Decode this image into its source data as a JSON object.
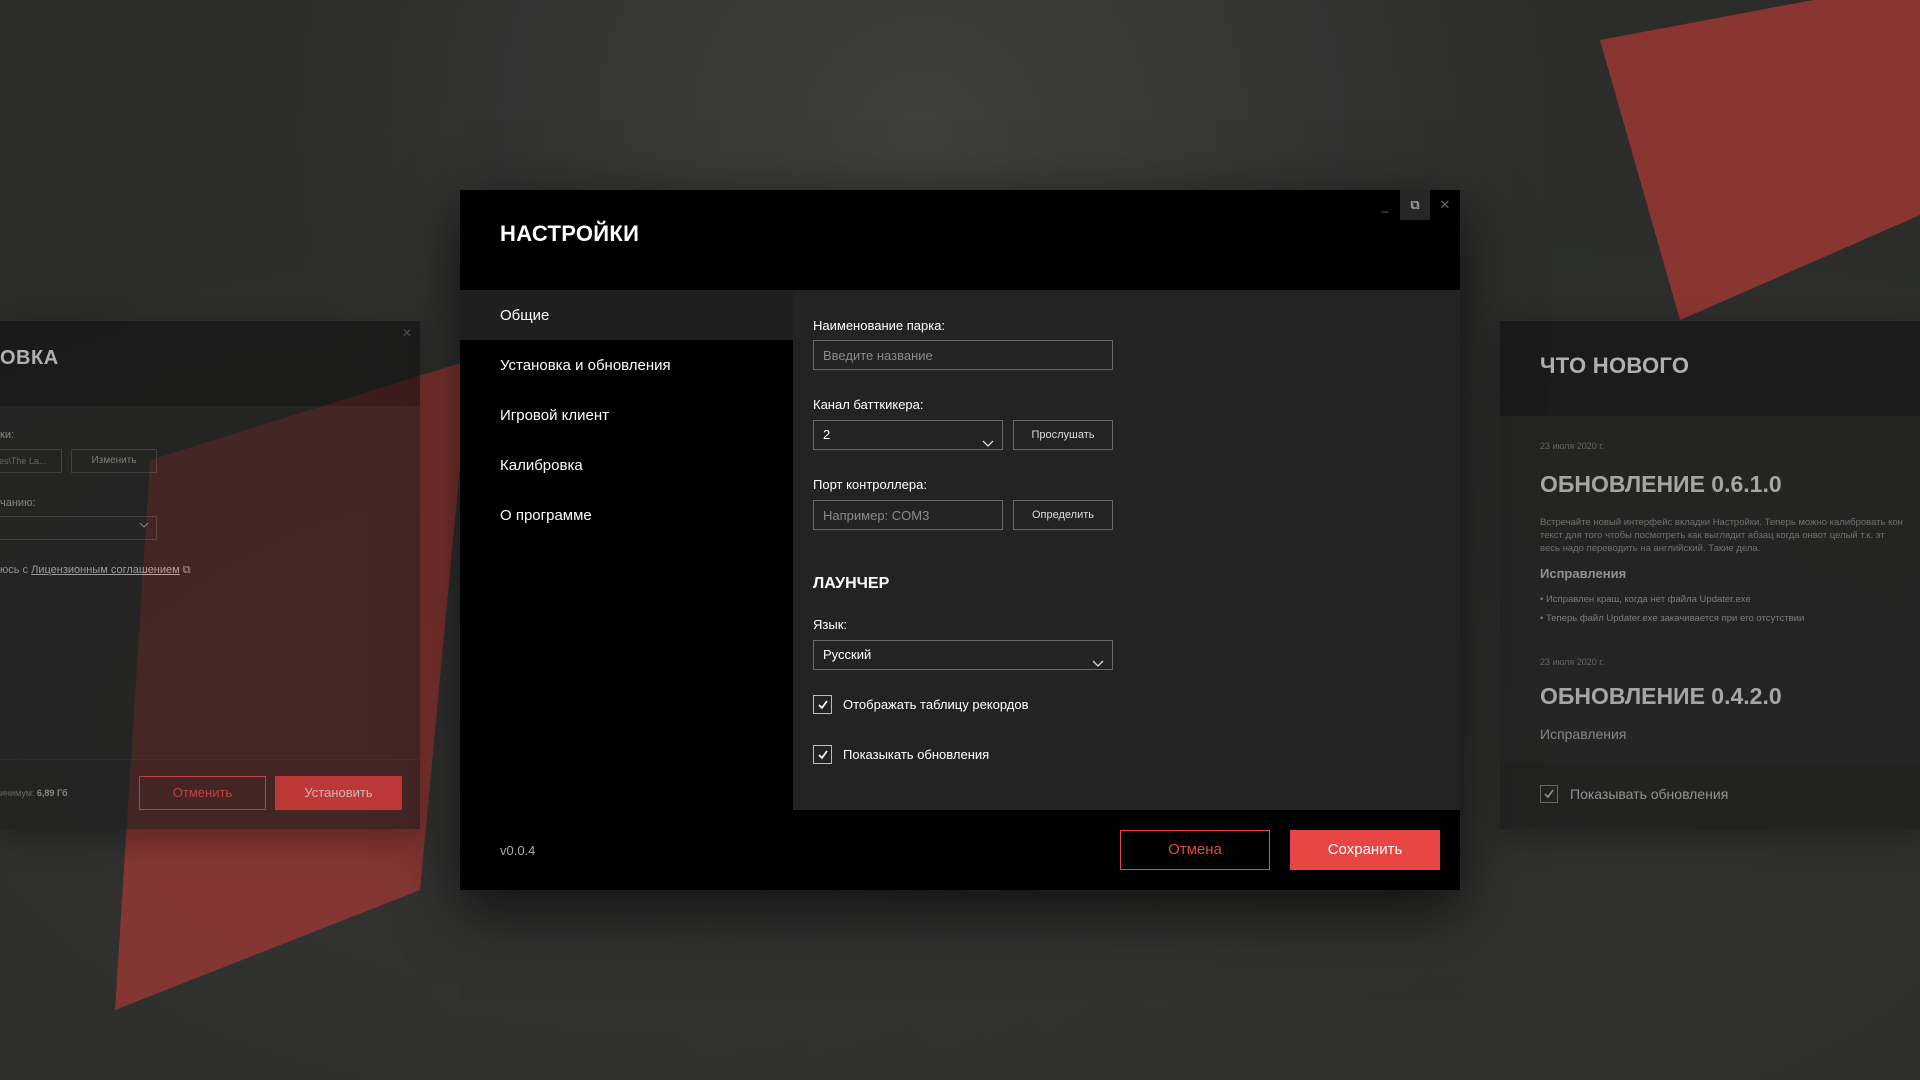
{
  "background": {
    "accent_color": "#c0403d"
  },
  "installer": {
    "title": "ОВКА",
    "path_label": "ки:",
    "path_value": "es\\The La...",
    "change_button": "Изменить",
    "default_label": "чанию:",
    "agree_text": "юсь с",
    "agree_link": "Лицензионным соглашением",
    "min_label": "инимум:",
    "min_value": "6,89 Гб",
    "cancel_button": "Отменить",
    "install_button": "Установить"
  },
  "whats_new": {
    "title": "ЧТО НОВОГО",
    "entries": [
      {
        "date": "23 июля 2020 г.",
        "title": "ОБНОВЛЕНИЕ 0.6.1.0",
        "text": [
          "Встречайте новый интерфейс вкладки Настройки. Теперь можно калибровать кон",
          "текст для того чтобы посмотреть как выглядит абзац когда онвот целый т.к. эт",
          "весь надо переводить на английский. Такие дела."
        ],
        "section": "Исправления",
        "fixes": [
          "Исправлен краш, когда нет файла Updater.exe",
          "Теперь файл Updater.exe закачивается при его отсутствии"
        ]
      },
      {
        "date": "23 июля 2020 г.",
        "title": "ОБНОВЛЕНИЕ 0.4.2.0",
        "section": "Исправления"
      }
    ],
    "show_updates_label": "Показывать обновления"
  },
  "settings": {
    "title": "НАСТРОЙКИ",
    "window_controls": {
      "minimize": "_",
      "restore": "⧉",
      "close": "✕"
    },
    "nav": [
      {
        "label": "Общие",
        "active": true
      },
      {
        "label": "Установка и обновления",
        "active": false
      },
      {
        "label": "Игровой клиент",
        "active": false
      },
      {
        "label": "Калибровка",
        "active": false
      },
      {
        "label": "О программе",
        "active": false
      }
    ],
    "park_name": {
      "label": "Наименование парка:",
      "placeholder": "Введите название",
      "value": ""
    },
    "buttkicker": {
      "label": "Канал батткикера:",
      "value": "2",
      "listen_button": "Прослушать"
    },
    "controller_port": {
      "label": "Порт контроллера:",
      "placeholder": "Например: COM3",
      "value": "",
      "detect_button": "Определить"
    },
    "launcher_section": "ЛАУНЧЕР",
    "language": {
      "label": "Язык:",
      "value": "Русский"
    },
    "show_leaderboard": {
      "label": "Отображать таблицу рекордов",
      "checked": true
    },
    "show_updates": {
      "label": "Показыкать обновления",
      "checked": true
    },
    "version": "v0.0.4",
    "cancel_button": "Отмена",
    "save_button": "Сохранить",
    "accent_color": "#e84545"
  }
}
